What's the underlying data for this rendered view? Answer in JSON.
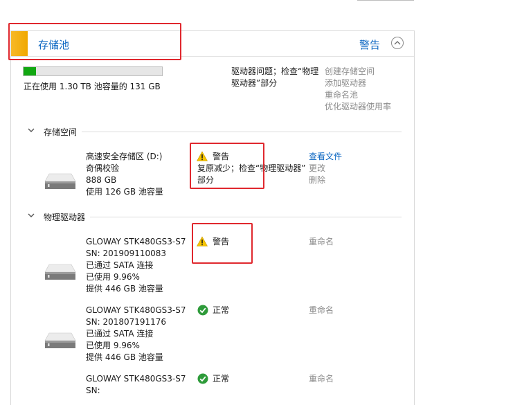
{
  "pool": {
    "title": "存储池",
    "status": "警告",
    "usage_fraction": 0.09,
    "usage_text": "正在使用 1.30 TB 池容量的 131 GB",
    "problem_line1": "驱动器问题；检查“物理",
    "problem_line2": "驱动器”部分",
    "actions": [
      "创建存储空间",
      "添加驱动器",
      "重命名池",
      "优化驱动器使用率"
    ]
  },
  "storage_spaces": {
    "section_label": "存储空间",
    "items": [
      {
        "name": "高速安全存储区 (D:)",
        "resiliency": "奇偶校验",
        "size": "888 GB",
        "usage": "使用 126 GB 池容量",
        "status_label": "警告",
        "status_detail_line1": "复原减少；检查“物理驱动器”",
        "status_detail_line2": "部分",
        "actions": [
          "查看文件",
          "更改",
          "删除"
        ]
      }
    ]
  },
  "physical_drives": {
    "section_label": "物理驱动器",
    "rename_label": "重命名",
    "items": [
      {
        "model": "GLOWAY STK480GS3-S7",
        "sn": "SN: 201909110083",
        "connection": "已通过 SATA 连接",
        "used": "已使用 9.96%",
        "capacity": "提供 446 GB 池容量",
        "status_label": "警告",
        "status_icon": "warning-icon"
      },
      {
        "model": "GLOWAY STK480GS3-S7",
        "sn": "SN: 201807191176",
        "connection": "已通过 SATA 连接",
        "used": "已使用 9.96%",
        "capacity": "提供 446 GB 池容量",
        "status_label": "正常",
        "status_icon": "ok-check-icon"
      },
      {
        "model": "GLOWAY STK480GS3-S7",
        "sn": "SN:",
        "connection": "",
        "used": "",
        "capacity": "",
        "status_label": "正常",
        "status_icon": "ok-check-icon"
      }
    ]
  },
  "colors": {
    "link": "#0b66c2",
    "warning": "#f5c400",
    "ok": "#2e9b3a",
    "usage_fill": "#12a812",
    "annotation": "#e0282e",
    "pool_stripe": "#f7b928"
  }
}
